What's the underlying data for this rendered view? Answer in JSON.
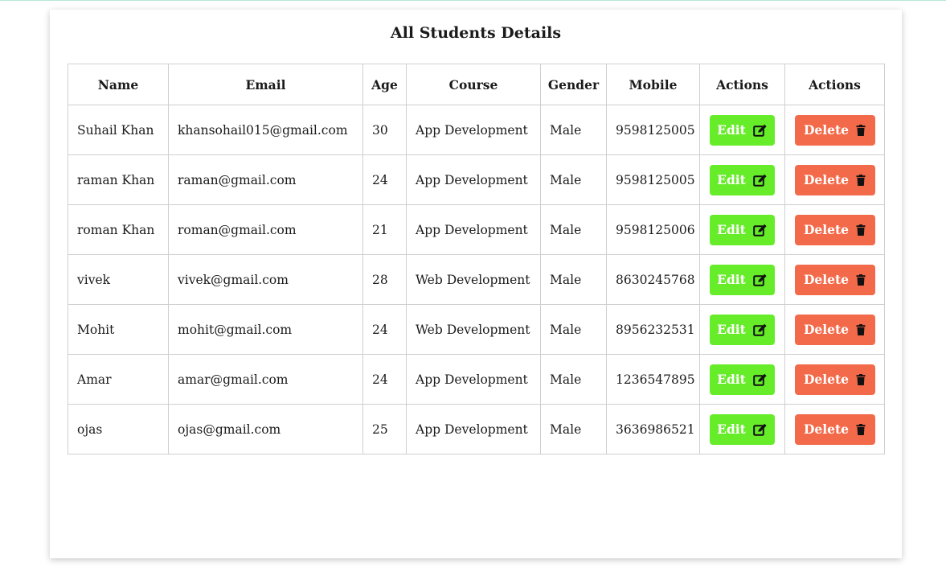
{
  "page": {
    "title": "All Students Details"
  },
  "colors": {
    "edit_button": "#66ec28",
    "delete_button": "#f36a4a",
    "border": "#cfcfcf"
  },
  "table": {
    "headers": [
      "Name",
      "Email",
      "Age",
      "Course",
      "Gender",
      "Mobile",
      "Actions",
      "Actions"
    ],
    "rows": [
      {
        "name": "Suhail Khan",
        "email": "khansohail015@gmail.com",
        "age": "30",
        "course": "App Development",
        "gender": "Male",
        "mobile": "9598125005",
        "edit_label": "Edit",
        "delete_label": "Delete"
      },
      {
        "name": "raman Khan",
        "email": "raman@gmail.com",
        "age": "24",
        "course": "App Development",
        "gender": "Male",
        "mobile": "9598125005",
        "edit_label": "Edit",
        "delete_label": "Delete"
      },
      {
        "name": "roman Khan",
        "email": "roman@gmail.com",
        "age": "21",
        "course": "App Development",
        "gender": "Male",
        "mobile": "9598125006",
        "edit_label": "Edit",
        "delete_label": "Delete"
      },
      {
        "name": "vivek",
        "email": "vivek@gmail.com",
        "age": "28",
        "course": "Web Development",
        "gender": "Male",
        "mobile": "8630245768",
        "edit_label": "Edit",
        "delete_label": "Delete"
      },
      {
        "name": "Mohit",
        "email": "mohit@gmail.com",
        "age": "24",
        "course": "Web Development",
        "gender": "Male",
        "mobile": "8956232531",
        "edit_label": "Edit",
        "delete_label": "Delete"
      },
      {
        "name": "Amar",
        "email": "amar@gmail.com",
        "age": "24",
        "course": "App Development",
        "gender": "Male",
        "mobile": "1236547895",
        "edit_label": "Edit",
        "delete_label": "Delete"
      },
      {
        "name": "ojas",
        "email": "ojas@gmail.com",
        "age": "25",
        "course": "App Development",
        "gender": "Male",
        "mobile": "3636986521",
        "edit_label": "Edit",
        "delete_label": "Delete"
      }
    ]
  },
  "icons": {
    "edit": "edit-icon",
    "delete": "trash-icon"
  }
}
